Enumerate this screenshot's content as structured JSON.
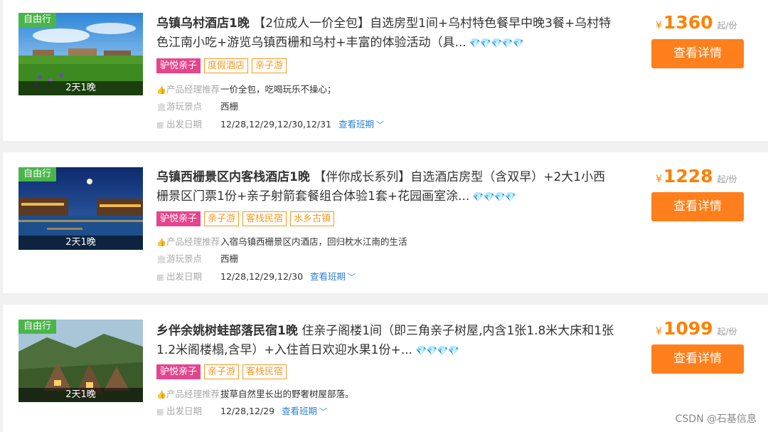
{
  "colors": {
    "accent_orange": "#ff7f1c",
    "price_orange": "#ff8000",
    "free_badge_green": "#4ab54a",
    "highlight_tag_pink": "#e4458d",
    "tag_orange": "#f39a23",
    "link_blue": "#2e82d6"
  },
  "labels": {
    "manager_recommend": "产品经理推荐",
    "scenic_spot": "游玩景点",
    "depart_date": "出发日期",
    "view_schedule": "查看班期",
    "view_details": "查看详情",
    "currency": "¥",
    "per_unit": "起/份",
    "gem_icons": "💎💎💎💎💎"
  },
  "icons": {
    "thumbs_up": "thumbs-up-icon",
    "building": "landmark-icon",
    "calendar": "calendar-icon",
    "chevron": "chevron-down-icon",
    "diamond": "diamond-rating-icon"
  },
  "products": [
    {
      "badge": "自由行",
      "duration": "2天1晚",
      "name": "乌镇乌村酒店1晚",
      "desc": " 【2位成人一价全包】自选房型1间+乌村特色餐早中晚3餐+乌村特色江南小吃+游览乌镇西栅和乌村+丰富的体验活动（具...",
      "gems": "💎💎💎💎💎",
      "diamond_count": 5,
      "tags": [
        "驴悦亲子",
        "度假酒店",
        "亲子游"
      ],
      "recommend": "一价全包，吃喝玩乐不操心；",
      "scenic": "西栅",
      "dates": "12/28,12/29,12/30,12/31",
      "price": "1360"
    },
    {
      "badge": "自由行",
      "duration": "2天1晚",
      "name": "乌镇西栅景区内客栈酒店1晚",
      "desc": " 【伴你成长系列】自选酒店房型（含双早）+2大1小西栅景区门票1份+亲子射箭套餐组合体验1套+花园画室涂...",
      "gems": "💎💎💎💎",
      "diamond_count": 4,
      "tags": [
        "驴悦亲子",
        "亲子游",
        "客栈民宿",
        "水乡古镇"
      ],
      "recommend": "入宿乌镇西栅景区内酒店，回归枕水江南的生活",
      "scenic": "西栅",
      "dates": "12/28,12/29,12/30",
      "price": "1228"
    },
    {
      "badge": "自由行",
      "duration": "2天1晚",
      "name": "乡伴余姚树蛙部落民宿1晚",
      "desc": " 住亲子阁楼1间（即三角亲子树屋,内含1张1.8米大床和1张1.2米阁楼榻,含早）+入住首日欢迎水果1份+...",
      "gems": "💎💎💎💎",
      "diamond_count": 4,
      "tags": [
        "驴悦亲子",
        "亲子游",
        "客栈民宿"
      ],
      "recommend": "拔草自然里长出的野奢树屋部落。",
      "dates": "12/28,12/29",
      "price": "1099"
    }
  ],
  "watermark": "CSDN @石基信息"
}
